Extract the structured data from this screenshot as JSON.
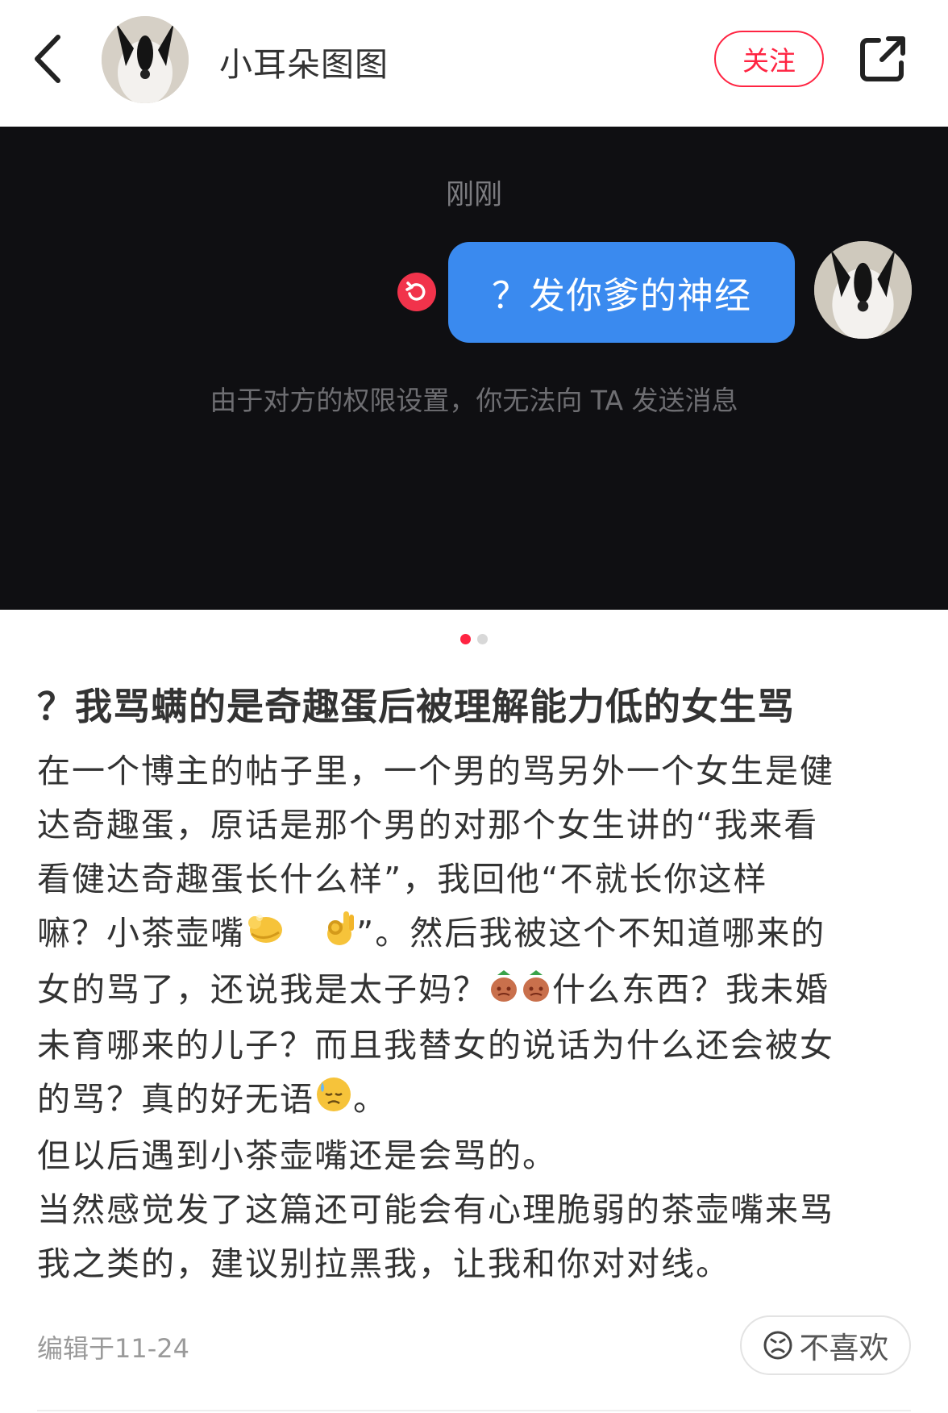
{
  "header": {
    "author_name": "小耳朵图图",
    "follow_label": "关注"
  },
  "photo": {
    "time_label": "刚刚",
    "message": "？发你爹的神经",
    "notice": "由于对方的权限设置，你无法向 TA 发送消息",
    "page_count": 2,
    "current_page": 1
  },
  "note": {
    "title": "？我骂螨的是奇趣蛋后被理解能力低的女生骂",
    "lines": [
      "在一个博主的帖子里，一个男的骂另外一个女生是健",
      "达奇趣蛋，原话是那个男的对那个女生讲的“我来看",
      "看健达奇趣蛋长什么样”，我回他“不就长你这样",
      "嘛？小茶壶嘴",
      "”。然后我被这个不知道哪来的",
      "女的骂了，还说我是太子妈？",
      "什么东西？我未婚",
      "未育哪来的儿子？而且我替女的说话为什么还会被女",
      "的骂？真的好无语",
      "。",
      "但以后遇到小茶壶嘴还是会骂的。",
      "当然感觉发了这篇还可能会有心理脆弱的茶壶嘴来骂",
      "我之类的，建议别拉黑我，让我和你对对线。"
    ],
    "edit_date": "编辑于11-24",
    "dislike_label": "不喜欢"
  },
  "icons": {
    "back": "chevron-left-icon",
    "share": "share-icon",
    "retry": "retry-icon",
    "dislike": "frown-icon",
    "pinch": "pinching-hand-emoji",
    "ok": "ok-hand-emoji",
    "bag": "money-bag-emoji",
    "sweat": "downcast-sweat-emoji"
  },
  "colors": {
    "accent": "#ff2442",
    "bubble": "#3a8aef",
    "photo_bg": "#0f0f12"
  }
}
